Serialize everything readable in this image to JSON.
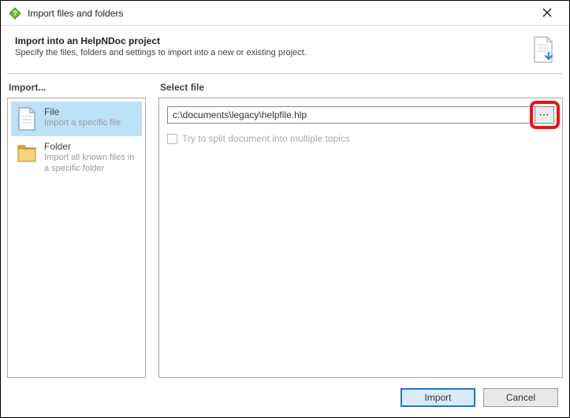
{
  "window": {
    "title": "Import files and folders"
  },
  "header": {
    "title": "Import into an HelpNDoc project",
    "subtitle": "Specify the files, folders and settings to import into a new or existing project."
  },
  "sidebar": {
    "label": "Import...",
    "items": [
      {
        "title": "File",
        "sub": "Import a specific file",
        "selected": true
      },
      {
        "title": "Folder",
        "sub": "Import all known files in a specific folder",
        "selected": false
      }
    ]
  },
  "main": {
    "label": "Select file",
    "path_value": "c:\\documents\\legacy\\helpfile.hlp",
    "browse_label": "⋯",
    "option_split": "Try to split document into multiple topics"
  },
  "footer": {
    "import": "Import",
    "cancel": "Cancel"
  }
}
